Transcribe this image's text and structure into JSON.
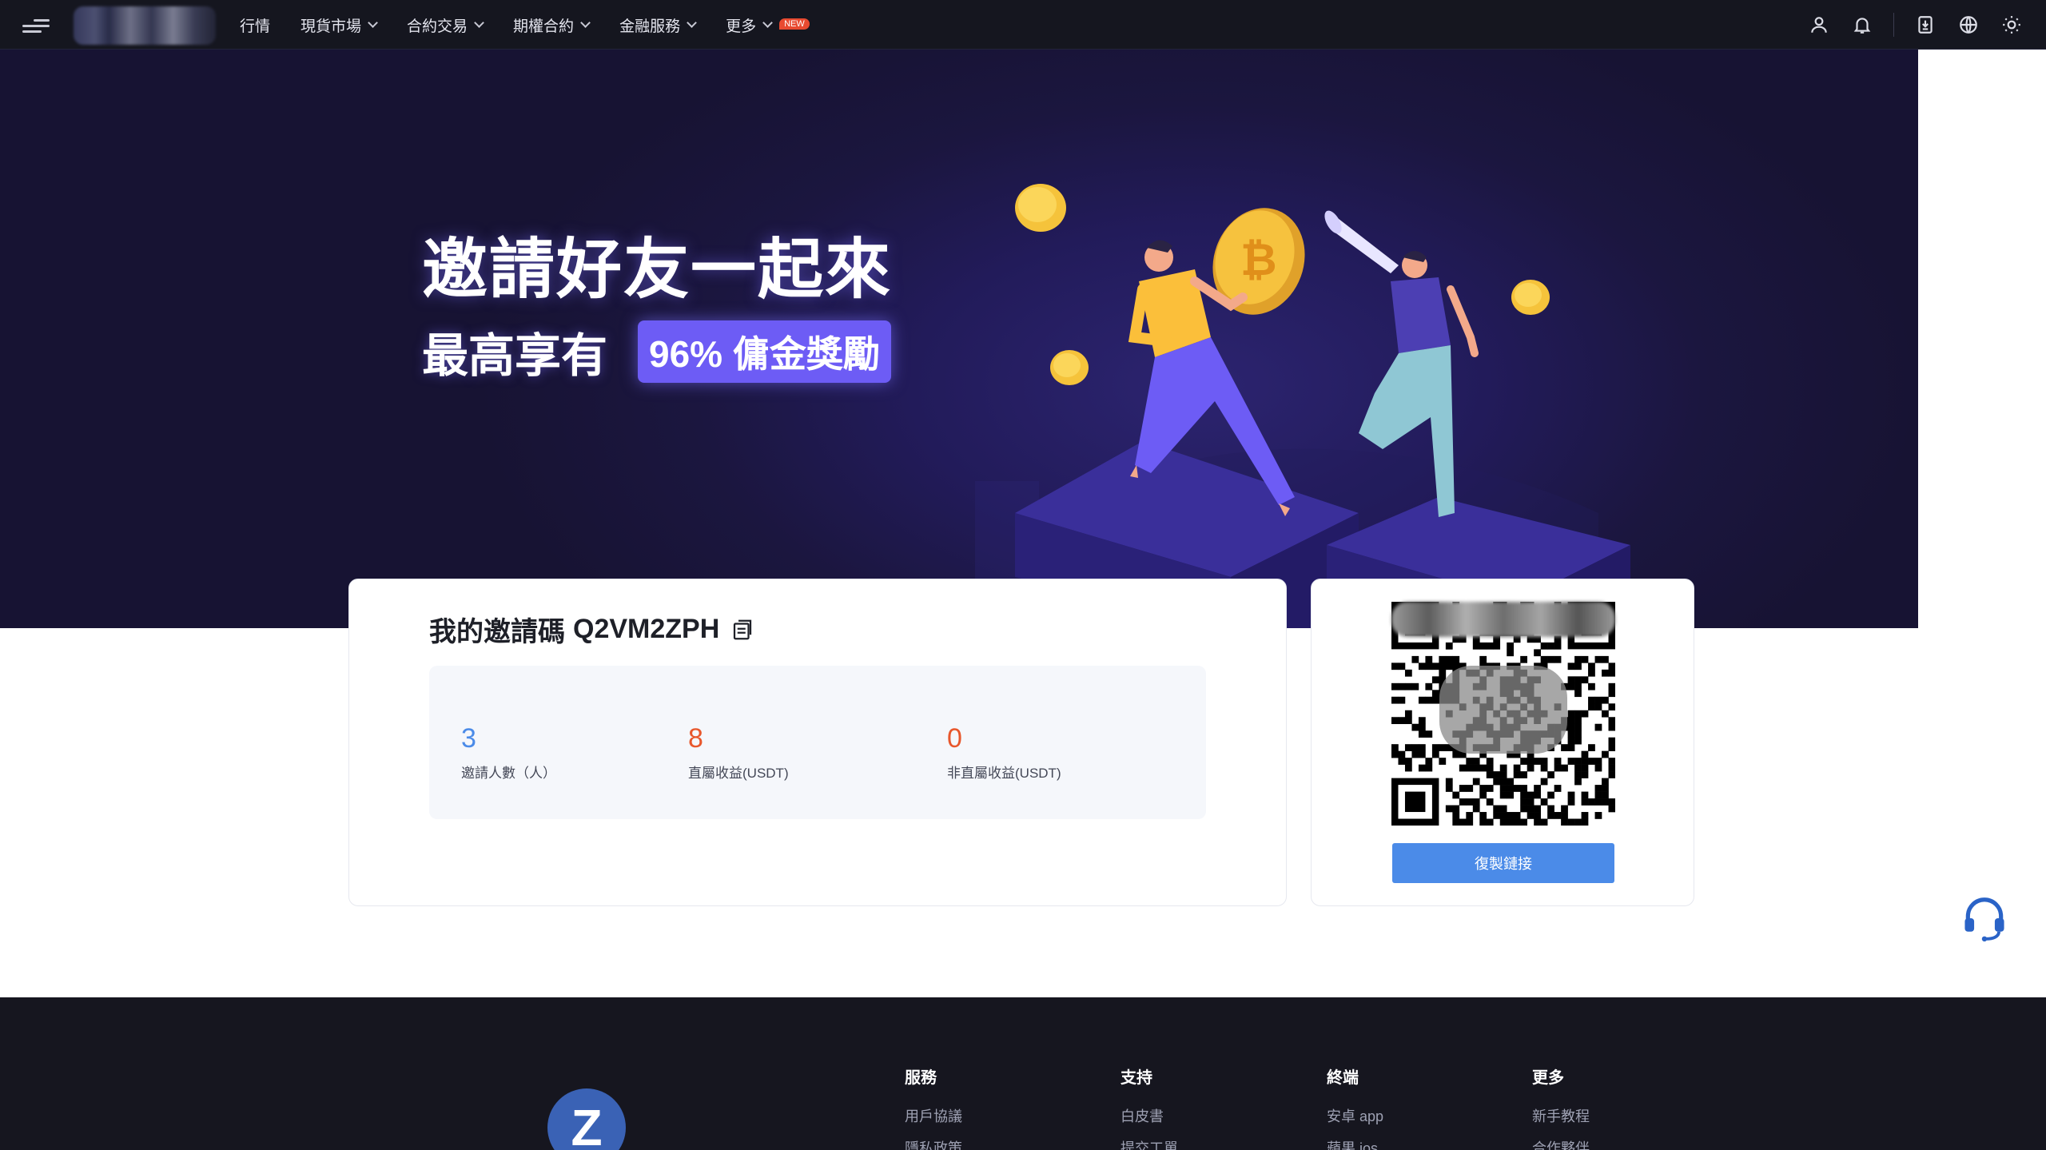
{
  "nav": {
    "links": [
      {
        "label": "行情",
        "has_dropdown": false
      },
      {
        "label": "現貨市場",
        "has_dropdown": true
      },
      {
        "label": "合約交易",
        "has_dropdown": true
      },
      {
        "label": "期權合約",
        "has_dropdown": true
      },
      {
        "label": "金融服務",
        "has_dropdown": true
      },
      {
        "label": "更多",
        "has_dropdown": true
      }
    ],
    "new_badge": "NEW",
    "icons": [
      "user-icon",
      "bell-icon",
      "download-icon",
      "globe-icon",
      "sun-icon"
    ]
  },
  "hero": {
    "title": "邀請好友一起來",
    "subtitle_lead": "最高享有",
    "subtitle_badge": "96% 傭金獎勵"
  },
  "invite": {
    "label": "我的邀請碼",
    "code": "Q2VM2ZPH",
    "stats": [
      {
        "value": "3",
        "label": "邀請人數（人）"
      },
      {
        "value": "8",
        "label": "直屬收益(USDT)"
      },
      {
        "value": "0",
        "label": "非直屬收益(USDT)"
      }
    ]
  },
  "qr": {
    "copy_link_label": "復製鏈接"
  },
  "footer": {
    "logo_letter": "Z",
    "columns": [
      {
        "heading": "服務",
        "items": [
          "用戶協議",
          "隱私政策"
        ]
      },
      {
        "heading": "支持",
        "items": [
          "白皮書",
          "提交工單"
        ]
      },
      {
        "heading": "終端",
        "items": [
          "安卓 app",
          "蘋果 ios"
        ]
      },
      {
        "heading": "更多",
        "items": [
          "新手教程",
          "合作夥伴"
        ]
      }
    ]
  },
  "colors": {
    "nav_bg": "#15161f",
    "hero_bg": "#1b163f",
    "accent_purple": "#6d5cf5",
    "accent_blue": "#4b8be8",
    "accent_orange": "#e8572c",
    "footer_bg": "#16161f"
  }
}
